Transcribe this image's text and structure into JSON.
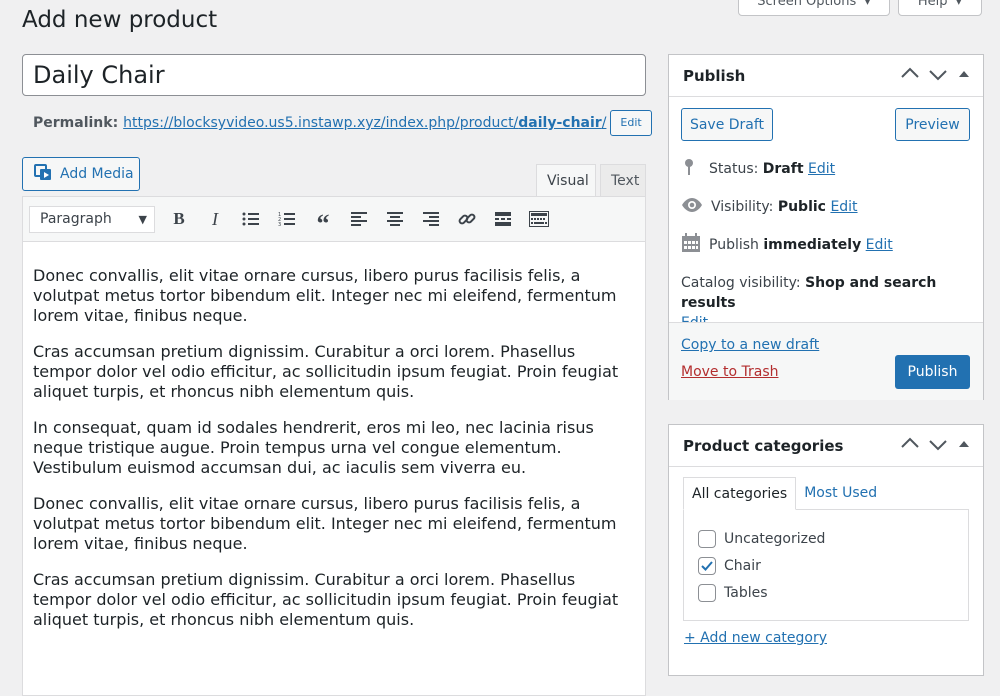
{
  "page": {
    "title": "Add new product"
  },
  "screen_options": {
    "screen_options_label": "Screen Options",
    "help_label": "Help"
  },
  "product": {
    "title": "Daily Chair",
    "permalink_label": "Permalink:",
    "permalink_base": "https://blocksyvideo.us5.instawp.xyz/index.php/product/",
    "permalink_slug": "daily-chair",
    "permalink_trail": "/",
    "permalink_edit": "Edit"
  },
  "editor": {
    "add_media": "Add Media",
    "tab_visual": "Visual",
    "tab_text": "Text",
    "format_select": "Paragraph",
    "toolbar_icons": [
      "bold-icon",
      "italic-icon",
      "bulleted-list-icon",
      "numbered-list-icon",
      "blockquote-icon",
      "align-left-icon",
      "align-center-icon",
      "align-right-icon",
      "insert-link-icon",
      "read-more-icon",
      "toolbar-toggle-icon"
    ],
    "paragraphs": [
      "Donec convallis, elit vitae ornare cursus, libero purus facilisis felis, a volutpat metus tortor bibendum elit. Integer nec mi eleifend, fermentum lorem vitae, finibus neque.",
      "Cras accumsan pretium dignissim. Curabitur a orci lorem. Phasellus tempor dolor vel odio efficitur, ac sollicitudin ipsum feugiat. Proin feugiat aliquet turpis, et rhoncus nibh elementum quis.",
      "In consequat, quam id sodales hendrerit, eros mi leo, nec lacinia risus neque tristique augue. Proin tempus urna vel congue elementum. Vestibulum euismod accumsan dui, ac iaculis sem viverra eu.",
      "Donec convallis, elit vitae ornare cursus, libero purus facilisis felis, a volutpat metus tortor bibendum elit. Integer nec mi eleifend, fermentum lorem vitae, finibus neque.",
      "Cras accumsan pretium dignissim. Curabitur a orci lorem. Phasellus tempor dolor vel odio efficitur, ac sollicitudin ipsum feugiat. Proin feugiat aliquet turpis, et rhoncus nibh elementum quis."
    ]
  },
  "publish": {
    "title": "Publish",
    "save_draft": "Save Draft",
    "preview": "Preview",
    "status_label": "Status:",
    "status_value": "Draft",
    "visibility_label": "Visibility:",
    "visibility_value": "Public",
    "publish_label": "Publish",
    "publish_value": "immediately",
    "catalog_label": "Catalog visibility:",
    "catalog_value": "Shop and search results",
    "edit": "Edit",
    "copy_draft": "Copy to a new draft",
    "trash": "Move to Trash",
    "publish_button": "Publish",
    "colors": {
      "primary": "#2271b1",
      "trash": "#b32d2e"
    }
  },
  "categories": {
    "title": "Product categories",
    "tab_all": "All categories",
    "tab_most_used": "Most Used",
    "items": [
      {
        "label": "Uncategorized",
        "checked": false
      },
      {
        "label": "Chair",
        "checked": true
      },
      {
        "label": "Tables",
        "checked": false
      }
    ],
    "add_new": "+ Add new category"
  }
}
